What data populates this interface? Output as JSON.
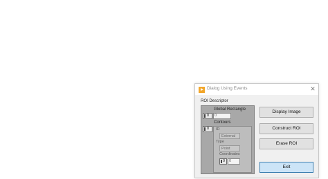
{
  "window": {
    "title": "Dialog Using Events",
    "close_glyph": "✕"
  },
  "roi_descriptor": {
    "label": "ROI Descriptor",
    "global_rectangle": {
      "label": "Global Rectangle",
      "index": "0",
      "value": "0"
    },
    "contours": {
      "label": "Contours",
      "index": "0",
      "id_label": "ID",
      "id_value": "External",
      "type_label": "Type",
      "type_value": "Point",
      "coords_label": "Coordinates",
      "coords_index": "0",
      "coords_value": "0"
    }
  },
  "buttons": {
    "display_image": "Display Image",
    "construct_roi": "Construct ROI",
    "erase_roi": "Erase ROI",
    "exit": "Exit"
  },
  "colors": {
    "accent": "#cce4f7",
    "accent_border": "#3c7fb1",
    "app_icon": "#f2a62a"
  }
}
